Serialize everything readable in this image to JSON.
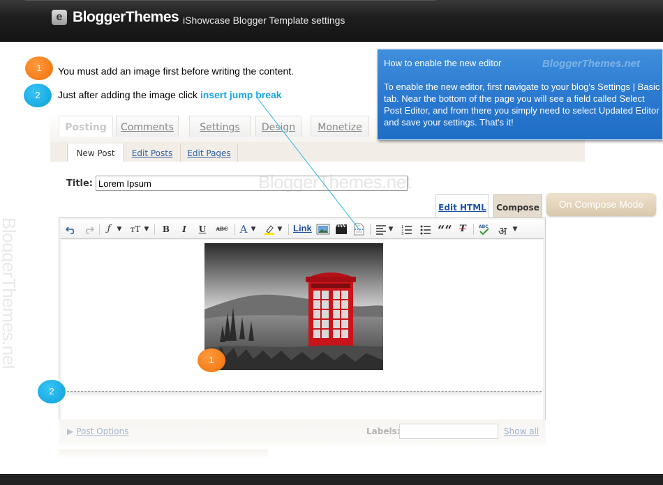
{
  "header": {
    "logo_letter": "e",
    "logo_text": "BloggerThemes",
    "subtitle": "iShowcase Blogger Template settings"
  },
  "watermark": "BloggerThemes.net",
  "steps": [
    {
      "number": "1",
      "text": "You must add an image first before writing the content.",
      "color": "#f4790e"
    },
    {
      "number": "2",
      "text_before": "Just after adding the image click ",
      "link": "insert jump break",
      "color": "#14a6e2"
    }
  ],
  "info_box": {
    "title": "How to enable the new editor",
    "watermark": "BloggerThemes.net",
    "body": "To enable the new editor, first navigate to your blog's Settings | Basic tab. Near the bottom of the page you will see a field called Select Post Editor, and from there you simply need to select Updated Editor and save your settings. That's it!",
    "background": "#2a78cf"
  },
  "editor": {
    "main_tabs": [
      "Posting",
      "Comments",
      "Settings",
      "Design",
      "Monetize"
    ],
    "sub_tabs": [
      "New Post",
      "Edit Posts",
      "Edit Pages"
    ],
    "title_label": "Title:",
    "title_value": "Lorem Ipsum",
    "edit_html_tab": "Edit HTML",
    "compose_tab": "Compose",
    "compose_mode_button": "On Compose Mode",
    "toolbar": {
      "font_glyph": "ƒ",
      "font_size_glyph": "ᴛT",
      "bold": "B",
      "italic": "I",
      "underline": "U",
      "strike": "ABC",
      "text_color": "A",
      "link": "Link",
      "quote": "““",
      "clear_format": "T",
      "transliterate": "अ"
    },
    "image_badge": "1",
    "jump_badge": "2",
    "post_options": "Post Options",
    "labels_label": "Labels:",
    "show_all": "Show all"
  }
}
